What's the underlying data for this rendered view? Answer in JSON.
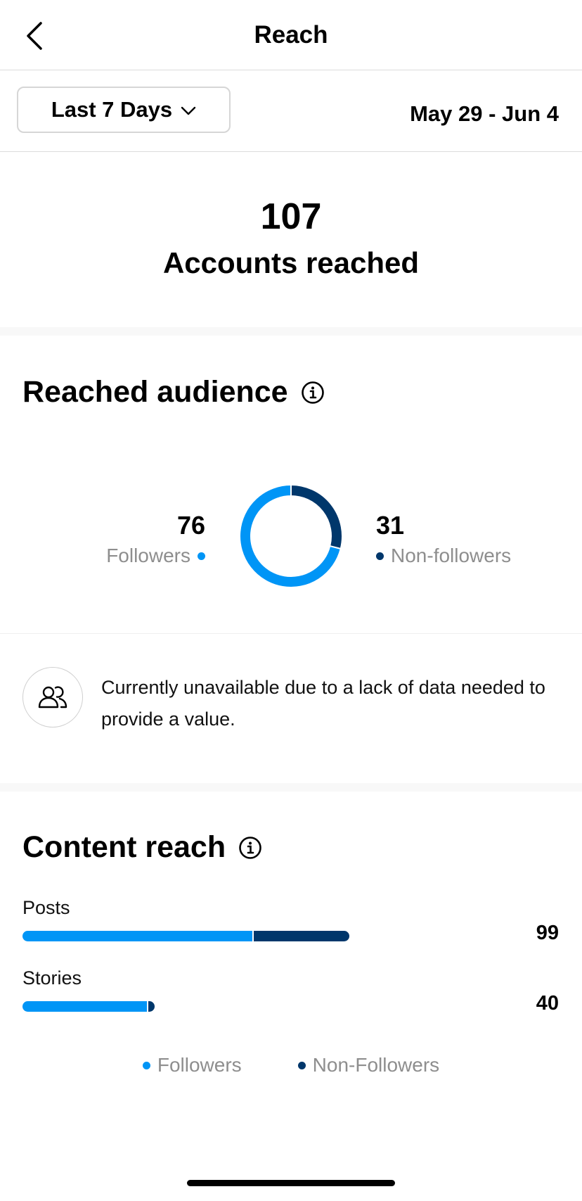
{
  "header": {
    "title": "Reach",
    "back_icon": "chevron-left-icon"
  },
  "range": {
    "selected": "Last 7 Days",
    "dates": "May 29 - Jun 4"
  },
  "total": {
    "value": "107",
    "label": "Accounts reached"
  },
  "audience": {
    "title": "Reached audience",
    "followers": {
      "value": "76",
      "label": "Followers"
    },
    "non_followers": {
      "value": "31",
      "label": "Non-followers"
    },
    "unavailable_text": "Currently unavailable due to a lack of data needed to provide a value."
  },
  "content_reach": {
    "title": "Content reach",
    "legend": {
      "followers": "Followers",
      "non_followers": "Non-Followers"
    }
  },
  "colors": {
    "followers": "#0095f6",
    "non_followers": "#00376b"
  },
  "chart_data": [
    {
      "type": "pie",
      "labels": [
        "Followers",
        "Non-followers"
      ],
      "values": [
        76,
        31
      ]
    },
    {
      "type": "bar",
      "categories": [
        "Posts",
        "Stories"
      ],
      "totals": [
        99,
        40
      ],
      "series": [
        {
          "name": "Followers",
          "values": [
            70,
            38
          ]
        },
        {
          "name": "Non-Followers",
          "values": [
            29,
            2
          ]
        }
      ]
    }
  ]
}
